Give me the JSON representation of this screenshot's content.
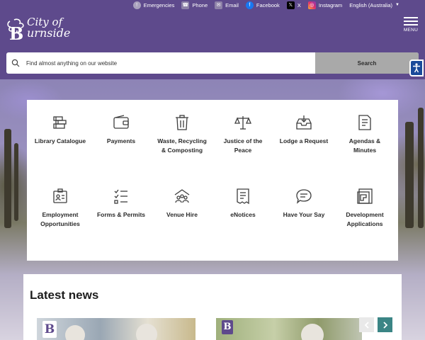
{
  "top_links": {
    "emergencies": "Emergencies",
    "phone": "Phone",
    "email": "Email",
    "facebook": "Facebook",
    "x": "X",
    "instagram": "Instagram",
    "language": "English (Australia)"
  },
  "logo": {
    "line1": "City of",
    "line2": "urnside",
    "initial": "B"
  },
  "menu_label": "MENU",
  "search": {
    "placeholder": "Find almost anything on our website",
    "button_label": "Search"
  },
  "quick_links": [
    {
      "label": "Library Catalogue",
      "icon": "books-icon"
    },
    {
      "label": "Payments",
      "icon": "wallet-icon"
    },
    {
      "label": "Waste, Recycling & Composting",
      "icon": "bin-icon"
    },
    {
      "label": "Justice of the Peace",
      "icon": "scales-icon"
    },
    {
      "label": "Lodge a Request",
      "icon": "inbox-icon"
    },
    {
      "label": "Agendas & Minutes",
      "icon": "document-icon"
    },
    {
      "label": "Employment Opportunities",
      "icon": "id-card-icon"
    },
    {
      "label": "Forms & Permits",
      "icon": "checklist-icon"
    },
    {
      "label": "Venue Hire",
      "icon": "venue-icon"
    },
    {
      "label": "eNotices",
      "icon": "notice-icon"
    },
    {
      "label": "Have Your Say",
      "icon": "speech-bubble-icon"
    },
    {
      "label": "Development Applications",
      "icon": "floor-plan-icon"
    }
  ],
  "news": {
    "title": "Latest news",
    "badge_letter": "B"
  },
  "colors": {
    "brand_purple": "#5e4a8c",
    "teal": "#3b8585",
    "search_button": "#a9a9a9"
  }
}
